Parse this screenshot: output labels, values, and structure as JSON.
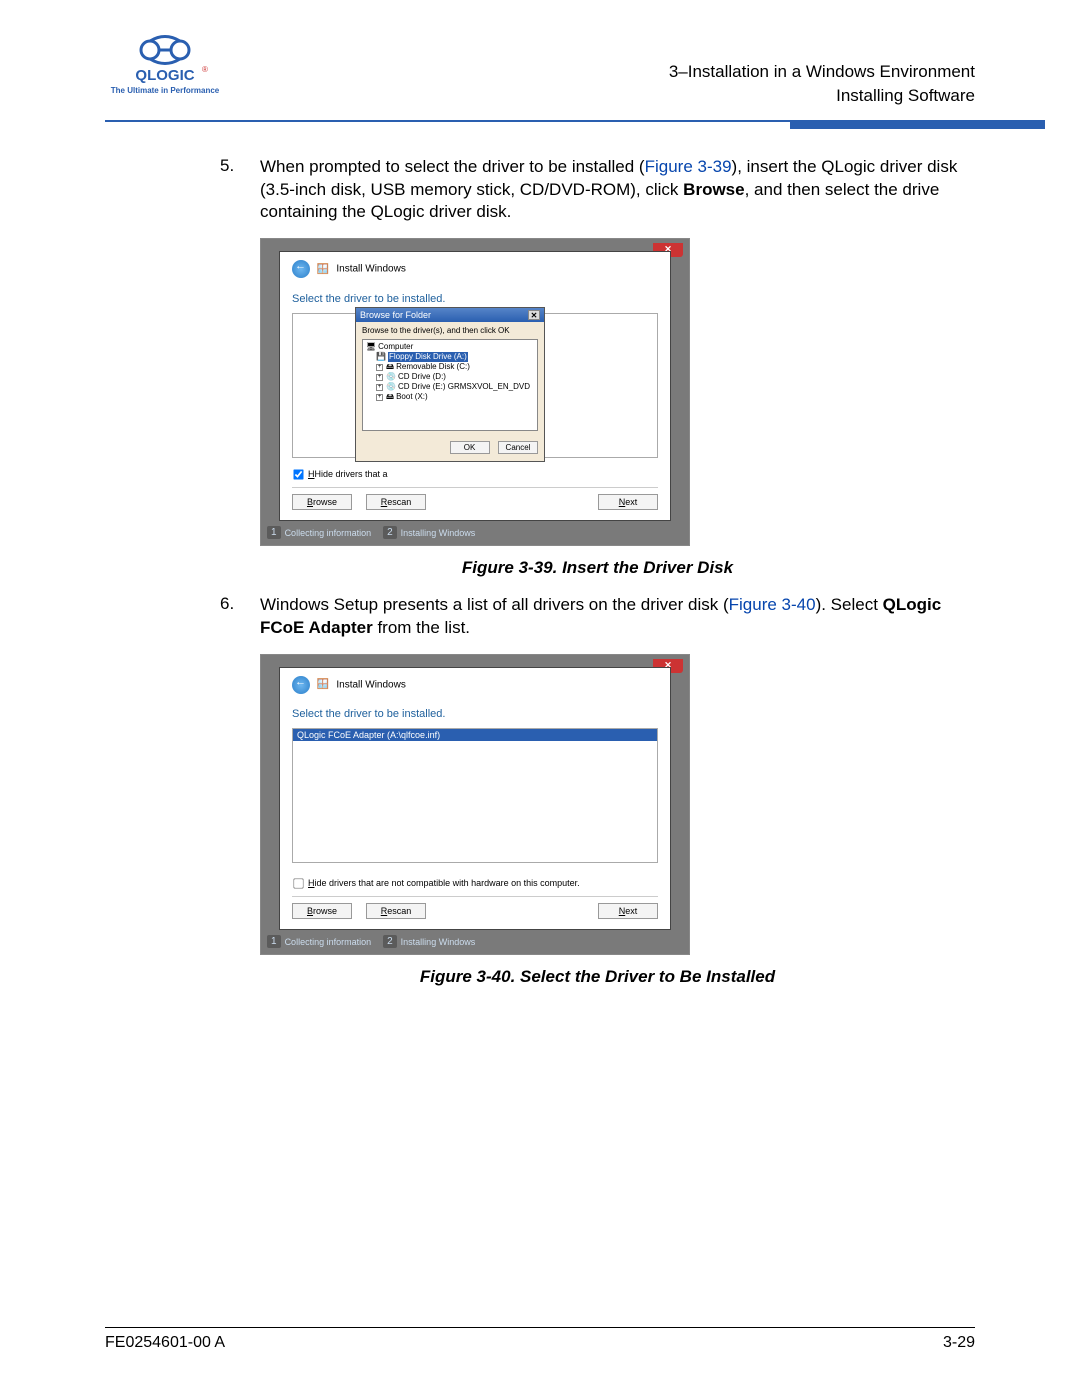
{
  "header": {
    "logo_text": "QLOGIC",
    "logo_tagline": "The Ultimate in Performance",
    "chapter_line": "3–Installation in a Windows Environment",
    "section_line": "Installing Software"
  },
  "step5": {
    "num": "5.",
    "text_before_link": "When prompted to select the driver to be installed (",
    "link": "Figure 3-39",
    "text_after_link": "), insert the QLogic driver disk (3.5-inch disk, USB memory stick, CD/DVD-ROM), click ",
    "bold": "Browse",
    "after_bold": ", and then select the drive containing the QLogic driver disk."
  },
  "fig39": {
    "window_title": "Install Windows",
    "heading": "Select the driver to be installed.",
    "hide_text": "Hide drivers that a",
    "browse": "Browse",
    "rescan": "Rescan",
    "next": "Next",
    "folder_title": "Browse for Folder",
    "folder_msg": "Browse to the driver(s), and then click OK",
    "tree_root": "Computer",
    "tree_floppy": "Floppy Disk Drive (A:)",
    "tree_removable": "Removable Disk (C:)",
    "tree_cd_d": "CD Drive (D:)",
    "tree_cd_e": "CD Drive (E:) GRMSXVOL_EN_DVD",
    "tree_boot": "Boot (X:)",
    "ok": "OK",
    "cancel": "Cancel",
    "prog1": "Collecting information",
    "prog2": "Installing Windows",
    "caption": "Figure 3-39. Insert the Driver Disk"
  },
  "step6": {
    "num": "6.",
    "text_before_link": "Windows Setup presents a list of all drivers on the driver disk (",
    "link": "Figure 3-40",
    "text_after_link": "). Select ",
    "bold": "QLogic FCoE Adapter",
    "after_bold": " from the list."
  },
  "fig40": {
    "window_title": "Install Windows",
    "heading": "Select the driver to be installed.",
    "driver_item": "QLogic FCoE Adapter (A:\\qlfcoe.inf)",
    "hide_text": "Hide drivers that are not compatible with hardware on this computer.",
    "browse": "Browse",
    "rescan": "Rescan",
    "next": "Next",
    "prog1": "Collecting information",
    "prog2": "Installing Windows",
    "caption": "Figure 3-40. Select the Driver to Be Installed"
  },
  "footer": {
    "doc_num": "FE0254601-00 A",
    "page": "3-29"
  }
}
